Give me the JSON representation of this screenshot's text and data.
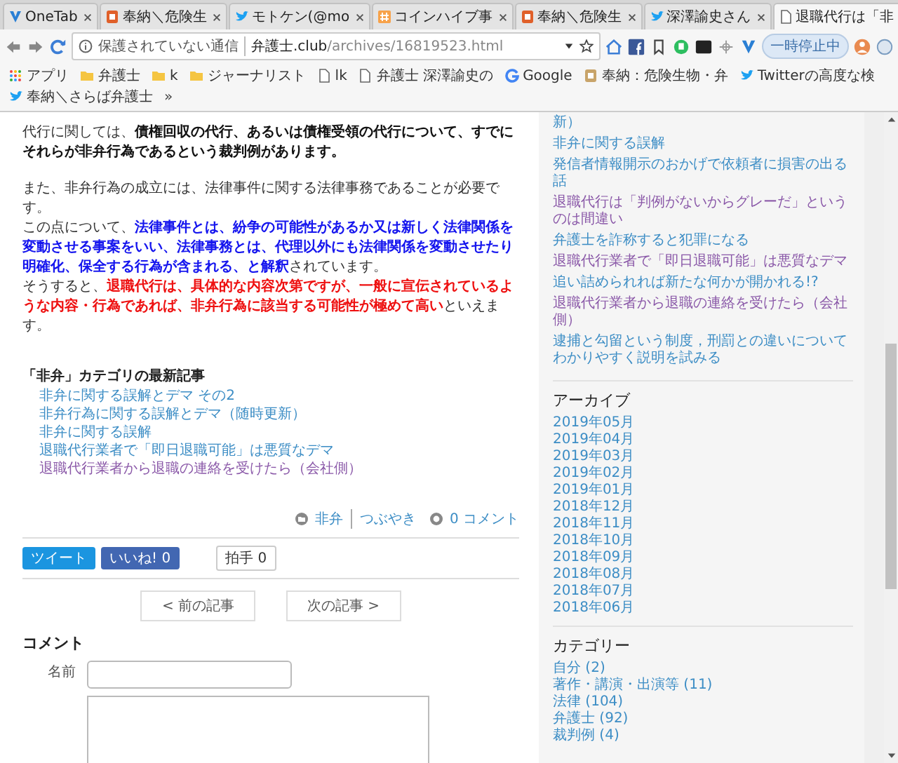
{
  "tabs": [
    {
      "title": "OneTab",
      "kind": "v",
      "selected": false
    },
    {
      "title": "奉納＼危険生",
      "kind": "blog",
      "selected": false
    },
    {
      "title": "モトケン(@mo",
      "kind": "bird",
      "selected": false
    },
    {
      "title": "コインハイブ事",
      "kind": "hash",
      "selected": false
    },
    {
      "title": "奉納＼危険生",
      "kind": "blog",
      "selected": false
    },
    {
      "title": "深澤諭史さん",
      "kind": "bird",
      "selected": false
    },
    {
      "title": "退職代行は「非",
      "kind": "doc",
      "selected": true
    }
  ],
  "address_bar": {
    "security": "保護されていない通信",
    "host": "弁護士.club",
    "path": "/archives/16819523.html"
  },
  "toolbar": {
    "paused_button": "一時停止中"
  },
  "bookmarks": [
    {
      "label": "アプリ",
      "kind": "apps"
    },
    {
      "label": "弁護士",
      "kind": "folder"
    },
    {
      "label": "k",
      "kind": "folder"
    },
    {
      "label": "ジャーナリスト",
      "kind": "folder"
    },
    {
      "label": "lk",
      "kind": "doc"
    },
    {
      "label": "弁護士 深澤諭史の",
      "kind": "doc"
    },
    {
      "label": "Google",
      "kind": "google"
    },
    {
      "label": "奉納：危険生物・弁",
      "kind": "blog"
    },
    {
      "label": "Twitterの高度な検",
      "kind": "bird"
    },
    {
      "label": "奉納＼さらば弁護士",
      "kind": "bird"
    }
  ],
  "bookmarks_more": "»",
  "article": {
    "paragraphs": [
      {
        "lines": [
          [
            {
              "text": "代行に関しては、",
              "kind": "plain"
            },
            {
              "text": "債権回収の代行、あるいは債権受領の代行について、すでにそれらが非弁行為であるという裁判例があります。",
              "kind": "bold"
            }
          ]
        ]
      },
      {
        "lines": [
          [
            {
              "text": "また、非弁行為の成立には、法律事件に関する法律事務であることが必要です。",
              "kind": "plain"
            }
          ],
          [
            {
              "text": "この点について、",
              "kind": "plain"
            },
            {
              "text": "法律事件とは、紛争の可能性があるか又は新しく法律関係を変動させる事案をいい、法律事務とは、代理以外にも法律関係を変動させたり明確化、保全する行為が含まれる、と解釈",
              "kind": "blue"
            },
            {
              "text": "されています。",
              "kind": "plain"
            }
          ],
          [
            {
              "text": "そうすると、",
              "kind": "plain"
            },
            {
              "text": "退職代行は、具体的な内容次第ですが、一般に宣伝されているような内容・行為であれば、非弁行為に該当する可能性が極めて高い",
              "kind": "red"
            },
            {
              "text": "といえます。",
              "kind": "plain"
            }
          ]
        ]
      }
    ]
  },
  "related": {
    "heading": "「非弁」カテゴリの最新記事",
    "items": [
      {
        "title": "非弁に関する誤解とデマ その2",
        "visited": false
      },
      {
        "title": "非弁行為に関する誤解とデマ（随時更新）",
        "visited": false
      },
      {
        "title": "非弁に関する誤解",
        "visited": false
      },
      {
        "title": "退職代行業者で「即日退職可能」は悪質なデマ",
        "visited": false
      },
      {
        "title": "退職代行業者から退職の連絡を受けたら（会社側）",
        "visited": true
      }
    ]
  },
  "meta": {
    "category": "非弁",
    "tag": "つぶやき",
    "comments": "0 コメント"
  },
  "share": {
    "tweet": "ツイート",
    "like": "いいね! 0",
    "clap": "拍手 0"
  },
  "nav": {
    "prev": "< 前の記事",
    "next": "次の記事 >"
  },
  "comment_form": {
    "heading": "コメント",
    "name_label": "名前"
  },
  "sidebar": {
    "recent": [
      {
        "title": "新）",
        "visited": false
      },
      {
        "title": "非弁に関する誤解",
        "visited": false
      },
      {
        "title": "発信者情報開示のおかげで依頼者に損害の出る話",
        "visited": false
      },
      {
        "title": "退職代行は「判例がないからグレーだ」というのは間違い",
        "visited": true
      },
      {
        "title": "弁護士を詐称すると犯罪になる",
        "visited": false
      },
      {
        "title": "退職代行業者で「即日退職可能」は悪質なデマ",
        "visited": true
      },
      {
        "title": "追い詰められれば新たな何かが開かれる!?",
        "visited": false
      },
      {
        "title": "退職代行業者から退職の連絡を受けたら（会社側）",
        "visited": true
      },
      {
        "title": "逮捕と勾留という制度，刑罰との違いについてわかりやすく説明を試みる",
        "visited": false
      }
    ],
    "archive_heading": "アーカイブ",
    "archives": [
      "2019年05月",
      "2019年04月",
      "2019年03月",
      "2019年02月",
      "2019年01月",
      "2018年12月",
      "2018年11月",
      "2018年10月",
      "2018年09月",
      "2018年08月",
      "2018年07月",
      "2018年06月"
    ],
    "category_heading": "カテゴリー",
    "categories": [
      "自分 (2)",
      "著作・講演・出演等 (11)",
      "法律 (104)",
      "弁護士 (92)",
      "裁判例 (4)"
    ]
  }
}
